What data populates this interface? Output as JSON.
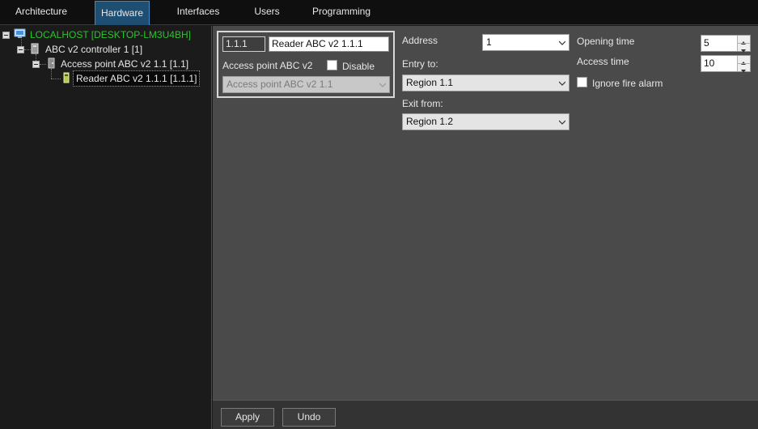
{
  "tabs": [
    {
      "label": "Architecture",
      "active": false
    },
    {
      "label": "Hardware",
      "active": true
    },
    {
      "label": "Interfaces",
      "active": false
    },
    {
      "label": "Users",
      "active": false
    },
    {
      "label": "Programming",
      "active": false
    }
  ],
  "tree": {
    "root": {
      "label": "LOCALHOST [DESKTOP-LM3U4BH]",
      "color": "#2ec22e",
      "icon": "computer-icon"
    },
    "controller": {
      "label": "ABC v2 controller 1 [1]",
      "icon": "controller-icon"
    },
    "access_point": {
      "label": "Access point ABC v2 1.1 [1.1]",
      "icon": "access-point-icon"
    },
    "reader": {
      "label": "Reader ABC v2 1.1.1 [1.1.1]",
      "icon": "reader-icon",
      "selected": true
    }
  },
  "device": {
    "id_value": "1.1.1",
    "name_value": "Reader ABC v2 1.1.1",
    "parent_label": "Access point ABC v2",
    "disable_label": "Disable",
    "disable_checked": false,
    "parent_select_value": "Access point ABC v2 1.1"
  },
  "address": {
    "label": "Address",
    "value": "1"
  },
  "entry": {
    "label": "Entry to:",
    "value": "Region 1.1"
  },
  "exit": {
    "label": "Exit from:",
    "value": "Region 1.2"
  },
  "opening_time": {
    "label": "Opening time",
    "value": "5"
  },
  "access_time": {
    "label": "Access time",
    "value": "10"
  },
  "ignore_fire": {
    "label": "Ignore fire alarm",
    "checked": false
  },
  "buttons": {
    "apply_label": "Apply",
    "undo_label": "Undo"
  }
}
